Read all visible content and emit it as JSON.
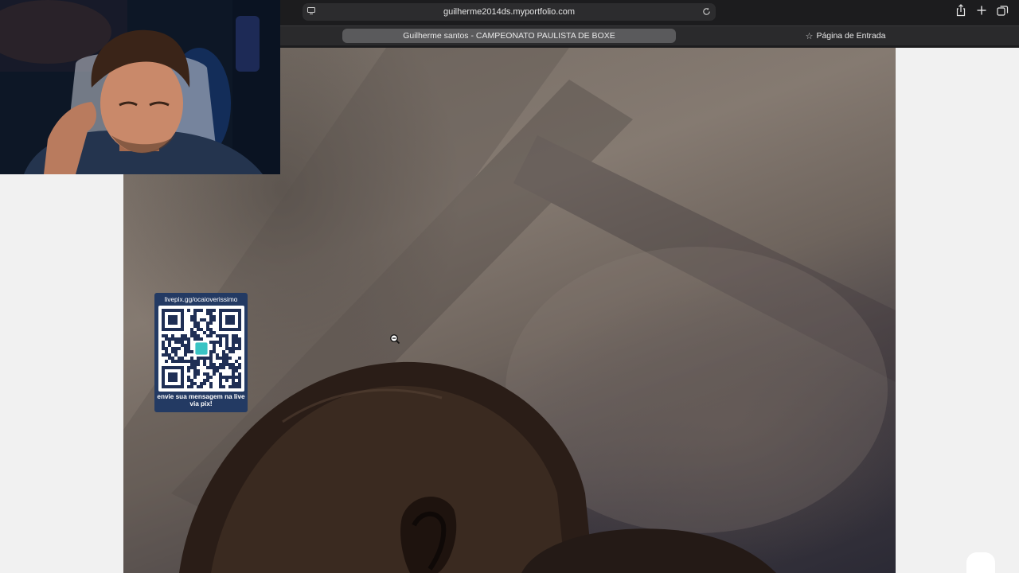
{
  "browser": {
    "url": "guilherme2014ds.myportfolio.com",
    "tabs": [
      {
        "label": "Guilherme santos - CAMPEONATO PAULISTA DE BOXE",
        "active": true
      },
      {
        "label": "Página de Entrada",
        "active": false
      }
    ],
    "icons": {
      "site": "page-settings-icon",
      "reload": "reload-icon",
      "share": "share-icon",
      "new_tab": "plus-icon",
      "tabs_overview": "tabs-overview-icon",
      "favorite": "star-icon"
    }
  },
  "page": {
    "photo": "boxer-photo",
    "cursor": "zoom-out-cursor"
  },
  "overlay": {
    "qr": {
      "url": "livepix.gg/ocaioverissimo",
      "message": "envie sua mensagem na live via pix!"
    },
    "webcam": "streamer-webcam"
  },
  "colors": {
    "chrome_bg": "#1c1c1e",
    "active_tab": "#5a5a5c",
    "qr_card": "#233a63",
    "page_bg": "#f1f1f1"
  }
}
